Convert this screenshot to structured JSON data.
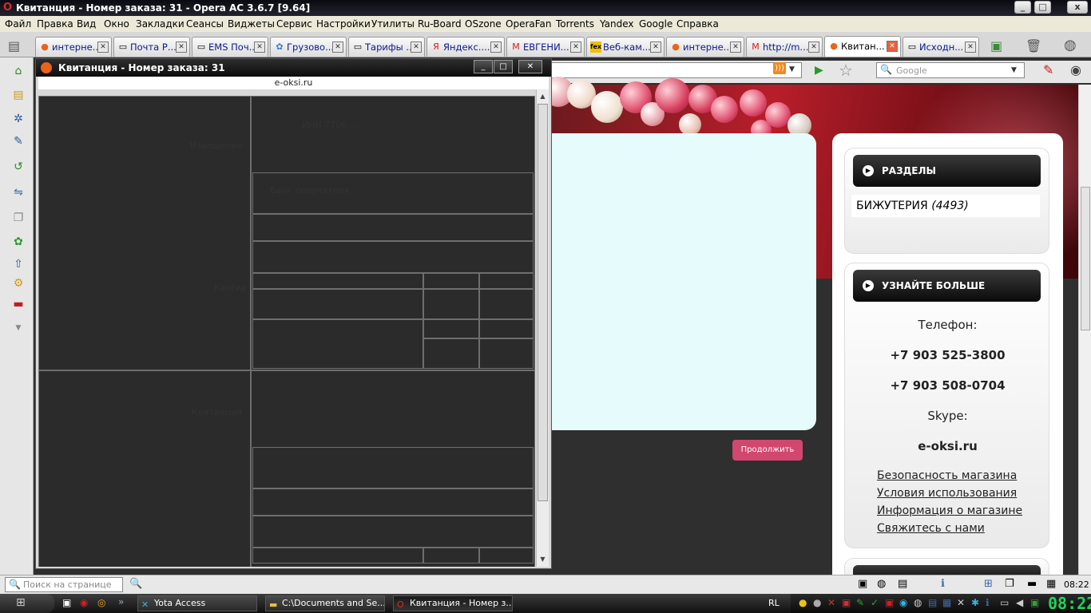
{
  "window": {
    "title": "Квитанция - Номер заказа: 31 - Opera AC 3.6.7 [9.64]",
    "minimize": "_",
    "maximize": "□",
    "close": "x"
  },
  "menu": [
    "Файл",
    "Правка",
    "Вид",
    "Окно",
    "Закладки",
    "Сеансы",
    "Виджеты",
    "Сервис",
    "Настройки",
    "Утилиты",
    "Ru-Board",
    "OSzone",
    "OperaFan",
    "Torrents",
    "Yandex",
    "Google",
    "Справка"
  ],
  "tabs": [
    {
      "label": "интерне...",
      "icon": "opera-icon"
    },
    {
      "label": "Почта Р...",
      "icon": "page-icon"
    },
    {
      "label": "EMS Поч...",
      "icon": "page-icon"
    },
    {
      "label": "Грузово...",
      "icon": "google-icon"
    },
    {
      "label": "Тарифы ...",
      "icon": "page-icon"
    },
    {
      "label": "Яндекс....",
      "icon": "yandex-icon"
    },
    {
      "label": "ЕВГЕНИ...",
      "icon": "gmail-icon"
    },
    {
      "label": "Веб-кам...",
      "icon": "fex-icon"
    },
    {
      "label": "интерне...",
      "icon": "opera-icon"
    },
    {
      "label": "http://m...",
      "icon": "gmail-icon"
    },
    {
      "label": "Квитан...",
      "icon": "opera-icon",
      "active": true
    },
    {
      "label": "Исходн...",
      "icon": "page-icon"
    }
  ],
  "search": {
    "placeholder": "Google"
  },
  "popup": {
    "title": "Квитанция - Номер заказа: 31",
    "address": "e-oksi.ru",
    "ghost_text": [
      "Извещение",
      "ИНН 7706....",
      "Банк получателя",
      "Кассир",
      "Квитанция",
      "Кассир"
    ]
  },
  "page": {
    "continue_button": "Продолжить",
    "sections_header": "РАЗДЕЛЫ",
    "sections_item_name": "БИЖУТЕРИЯ",
    "sections_item_count": "(4493)",
    "learn_more_header": "УЗНАЙТЕ БОЛЬШЕ",
    "phone_label": "Телефон:",
    "phone1": "+7 903 525-3800",
    "phone2": "+7 903 508-0704",
    "skype_label": "Skype:",
    "skype_value": "e-oksi.ru",
    "links": [
      "Безопасность магазина",
      "Условия использования",
      "Информация о магазине",
      "Свяжитесь с нами"
    ]
  },
  "statusbar": {
    "find_placeholder": "Поиск на странице",
    "time": "08:22"
  },
  "taskbar": {
    "tasks": [
      {
        "label": "Yota Access",
        "icon": "yota-icon"
      },
      {
        "label": "C:\\Documents and Se...",
        "icon": "folder-icon"
      },
      {
        "label": "Квитанция - Номер з...",
        "icon": "opera-icon",
        "active": true
      }
    ],
    "language": "RL",
    "clock": "08:22"
  }
}
